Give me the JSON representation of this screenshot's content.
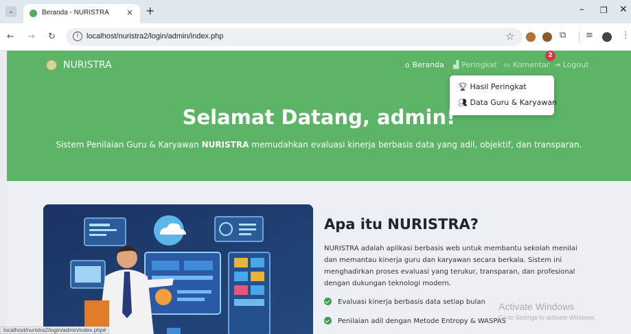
{
  "browser": {
    "tab_title": "Beranda - NURISTRA",
    "url": "localhost/nuristra2/login/admin/index.php",
    "status_url": "localhost/nuristra2/login/admin/index.php#"
  },
  "navbar": {
    "brand": "NURISTRA",
    "items": [
      {
        "icon": "home-icon",
        "label": "Beranda"
      },
      {
        "icon": "bar-chart-icon",
        "label": "Peringkat"
      },
      {
        "icon": "comment-icon",
        "label": "Komentar"
      },
      {
        "icon": "logout-icon",
        "label": "Logout"
      }
    ],
    "badge": "2"
  },
  "dropdown": {
    "items": [
      {
        "icon": "trophy-icon",
        "label": "Hasil Peringkat"
      },
      {
        "icon": "users-icon",
        "label": "Data Guru & Karyawan"
      }
    ]
  },
  "hero": {
    "title": "Selamat Datang, admin!",
    "subtitle_before": "Sistem Penilaian Guru & Karyawan ",
    "subtitle_bold": "NURISTRA",
    "subtitle_after": " memudahkan evaluasi kinerja berbasis data yang adil, objektif, dan transparan."
  },
  "about": {
    "title": "Apa itu NURISTRA?",
    "paragraph": "NURISTRA adalah aplikasi berbasis web untuk membantu sekolah menilai dan memantau kinerja guru dan karyawan secara berkala. Sistem ini menghadirkan proses evaluasi yang terukur, transparan, dan profesional dengan dukungan teknologi modern.",
    "features": [
      "Evaluasi kinerja berbasis data setiap bulan",
      "Penilaian adil dengan Metode Entropy & WASPAS"
    ]
  },
  "watermark": {
    "line1": "Activate Windows",
    "line2": "Go to Settings to activate Windows."
  },
  "colors": {
    "primary": "#5cb466",
    "badge": "#dc3545",
    "check": "#3c9b4b"
  }
}
